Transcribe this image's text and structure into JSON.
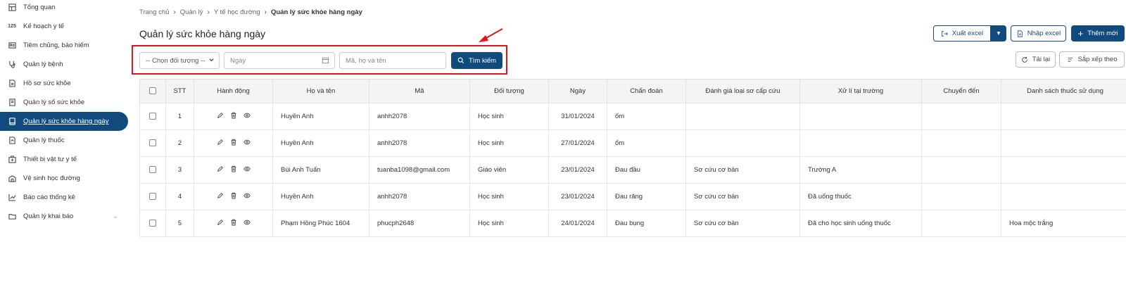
{
  "sidebar": {
    "items": [
      {
        "label": "Tổng quan",
        "icon": "dashboard-icon"
      },
      {
        "label": "Kế hoạch y tế",
        "icon": "number-125-icon",
        "num": "125"
      },
      {
        "label": "Tiêm chủng, bảo hiểm",
        "icon": "id-card-icon"
      },
      {
        "label": "Quản lý bệnh",
        "icon": "stethoscope-icon"
      },
      {
        "label": "Hồ sơ sức khỏe",
        "icon": "document-icon"
      },
      {
        "label": "Quản lý sổ sức khỏe",
        "icon": "book-icon"
      },
      {
        "label": "Quản lý sức khỏe hàng ngày",
        "icon": "tablet-icon",
        "active": true
      },
      {
        "label": "Quản lý thuốc",
        "icon": "medicine-icon"
      },
      {
        "label": "Thiết bị vật tư y tế",
        "icon": "medical-kit-icon"
      },
      {
        "label": "Vệ sinh học đường",
        "icon": "school-icon"
      },
      {
        "label": "Báo cáo thống kê",
        "icon": "chart-icon"
      },
      {
        "label": "Quản lý khai báo",
        "icon": "folder-icon",
        "expandable": true
      }
    ]
  },
  "breadcrumb": [
    "Trang chủ",
    "Quản lý",
    "Y tế học đường",
    "Quản lý sức khỏe hàng ngày"
  ],
  "page_title": "Quản lý sức khỏe hàng ngày",
  "filters": {
    "target_select": "-- Chọn đối tượng --",
    "date_placeholder": "Ngày",
    "search_placeholder": "Mã, họ và tên",
    "search_button": "Tìm kiếm"
  },
  "toolbar": {
    "export_label": "Xuất excel",
    "import_label": "Nhập excel",
    "add_label": "Thêm mới",
    "reload_label": "Tải lại",
    "sort_label": "Sắp xếp theo"
  },
  "table": {
    "headers": [
      "STT",
      "Hành động",
      "Họ và tên",
      "Mã",
      "Đối tượng",
      "Ngày",
      "Chẩn đoán",
      "Đánh giá loại sơ cấp cứu",
      "Xử lí tại trường",
      "Chuyển đến",
      "Danh sách thuốc sử dụng"
    ],
    "rows": [
      {
        "stt": "1",
        "name": "Huyền Anh",
        "code": "anhh2078",
        "type": "Học sinh",
        "date": "31/01/2024",
        "diag": "ốm",
        "eval": "",
        "handle": "",
        "transfer": "",
        "meds": ""
      },
      {
        "stt": "2",
        "name": "Huyền Anh",
        "code": "anhh2078",
        "type": "Học sinh",
        "date": "27/01/2024",
        "diag": "ốm",
        "eval": "",
        "handle": "",
        "transfer": "",
        "meds": ""
      },
      {
        "stt": "3",
        "name": "Bùi Anh Tuấn",
        "code": "tuanba1098@gmail.com",
        "type": "Giáo viên",
        "date": "23/01/2024",
        "diag": "Đau đầu",
        "eval": "Sơ cứu cơ bản",
        "handle": "Trường A",
        "transfer": "",
        "meds": ""
      },
      {
        "stt": "4",
        "name": "Huyền Anh",
        "code": "anhh2078",
        "type": "Học sinh",
        "date": "23/01/2024",
        "diag": "Đau răng",
        "eval": "Sơ cứu cơ bản",
        "handle": "Đã uống thuốc",
        "transfer": "",
        "meds": ""
      },
      {
        "stt": "5",
        "name": "Phạm Hồng Phúc 1604",
        "code": "phucph2648",
        "type": "Học sinh",
        "date": "24/01/2024",
        "diag": "Đau bụng",
        "eval": "Sơ cứu cơ bản",
        "handle": "Đã cho học sinh uống thuốc",
        "transfer": "",
        "meds": "Hoa mộc trắng"
      }
    ]
  },
  "colors": {
    "primary": "#114a7d",
    "highlight_border": "#e3141b"
  }
}
